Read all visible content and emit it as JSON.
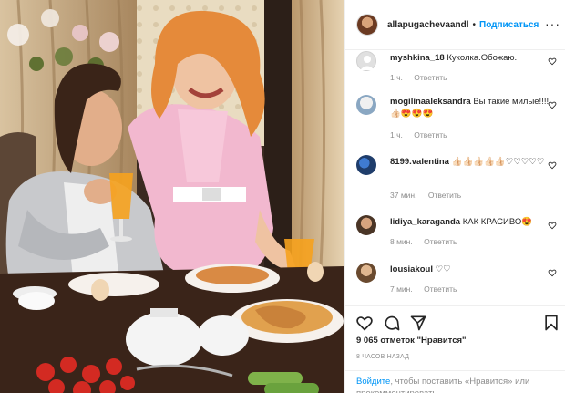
{
  "post": {
    "username": "allapugachevaandl",
    "separator": "•",
    "follow_label": "Подписаться",
    "more_label": "···"
  },
  "comments": [
    {
      "username": "myshkina_18",
      "text": "Куколка.Обожаю.",
      "time": "1 ч.",
      "reply": "Ответить"
    },
    {
      "username": "mogilinaaleksandra",
      "text": "Вы такие милые!!!!👍🏻😍😍😍",
      "time": "1 ч.",
      "reply": "Ответить"
    },
    {
      "username": "8199.valentina",
      "text": "👍🏻👍🏻👍🏻👍🏻👍🏻♡♡♡♡♡",
      "time": "37 мин.",
      "reply": "Ответить"
    },
    {
      "username": "lidiya_karaganda",
      "text": "КАК КРАСИВО😍",
      "time": "8 мин.",
      "reply": "Ответить"
    },
    {
      "username": "lousiakoul",
      "text": "♡♡",
      "time": "7 мин.",
      "reply": "Ответить"
    }
  ],
  "stats": {
    "likes": "9 065 отметок \"Нравится\"",
    "posted": "8 ЧАСОВ НАЗАД"
  },
  "login_prompt": {
    "link": "Войдите",
    "text": ", чтобы поставить «Нравится» или прокомментировать."
  },
  "icons": {
    "like": "heart-icon",
    "comment": "comment-icon",
    "share": "share-icon",
    "save": "bookmark-icon",
    "more": "more-icon"
  },
  "colors": {
    "accent": "#0095f6",
    "muted": "#8e8e8e",
    "text": "#262626",
    "border": "#efefef"
  }
}
